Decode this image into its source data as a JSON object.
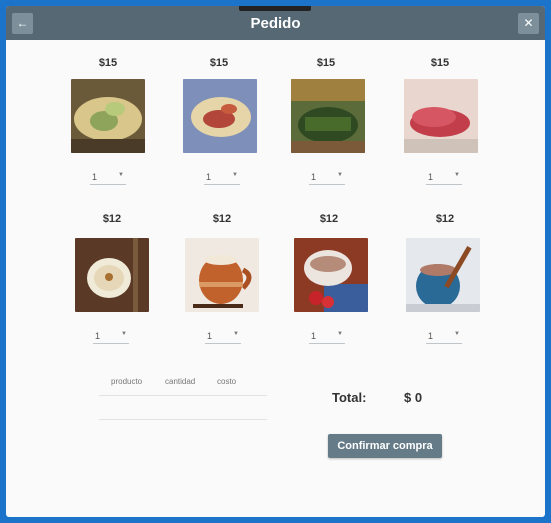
{
  "window": {
    "title": "Pedido",
    "back_icon": "arrow-left-icon",
    "close_icon": "close-icon"
  },
  "products": [
    {
      "price": "$15",
      "qty": "1",
      "image": "tamal-verde"
    },
    {
      "price": "$15",
      "qty": "1",
      "image": "tamal-rajas"
    },
    {
      "price": "$15",
      "qty": "1",
      "image": "tamal-oaxaqueno"
    },
    {
      "price": "$15",
      "qty": "1",
      "image": "tamal-rosa"
    },
    {
      "price": "$12",
      "qty": "1",
      "image": "atole-blanco"
    },
    {
      "price": "$12",
      "qty": "1",
      "image": "atole-jarrito"
    },
    {
      "price": "$12",
      "qty": "1",
      "image": "chocolate-taza"
    },
    {
      "price": "$12",
      "qty": "1",
      "image": "champurrado"
    }
  ],
  "order_table": {
    "headers": [
      "producto",
      "cantidad",
      "costo"
    ]
  },
  "total": {
    "label": "Total:",
    "value": "$ 0"
  },
  "confirm_label": "Confirmar compra",
  "colors": {
    "titlebar": "#556874",
    "button": "#657b88",
    "frame": "#1b74c9"
  }
}
